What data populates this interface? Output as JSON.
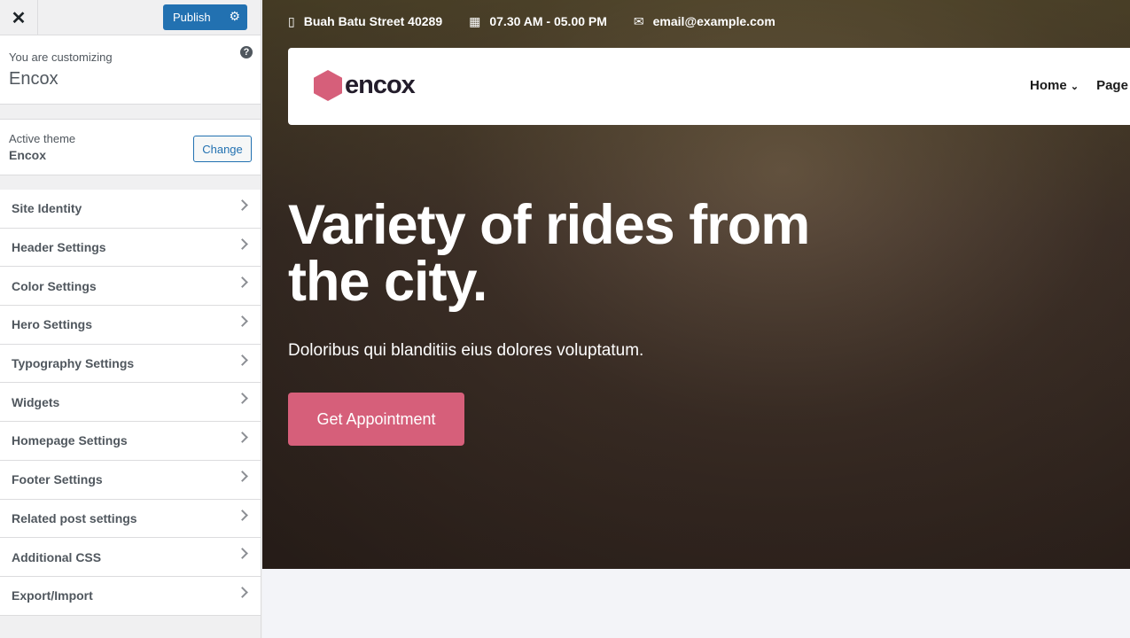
{
  "sidebar": {
    "close_label": "✕",
    "publish_label": "Publish",
    "customizing_label": "You are customizing",
    "site_name": "Encox",
    "active_theme_label": "Active theme",
    "active_theme": "Encox",
    "change_label": "Change",
    "help": "?",
    "items": [
      {
        "label": "Site Identity"
      },
      {
        "label": "Header Settings"
      },
      {
        "label": "Color Settings"
      },
      {
        "label": "Hero Settings"
      },
      {
        "label": "Typography Settings"
      },
      {
        "label": "Widgets"
      },
      {
        "label": "Homepage Settings"
      },
      {
        "label": "Footer Settings"
      },
      {
        "label": "Related post settings"
      },
      {
        "label": "Additional CSS"
      },
      {
        "label": "Export/Import"
      }
    ]
  },
  "preview": {
    "address": "Buah Batu Street 40289",
    "hours": "07.30 AM - 05.00 PM",
    "email": "email@example.com",
    "logo_text": "encox",
    "nav": [
      "Home",
      "Page"
    ],
    "hero_title": "Variety of rides from the city.",
    "hero_subtitle": "Doloribus qui blanditiis eius dolores voluptatum.",
    "cta": "Get Appointment",
    "accent": "#d65f7a"
  }
}
